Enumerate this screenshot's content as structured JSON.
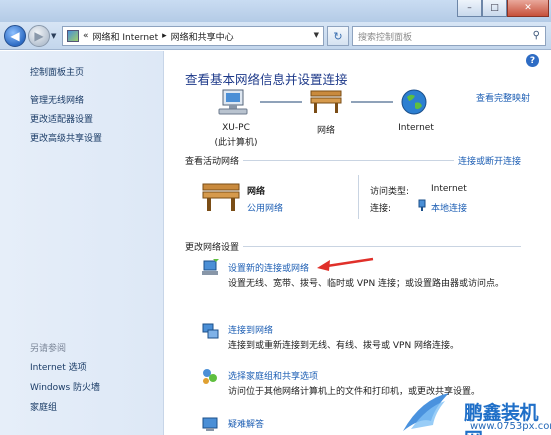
{
  "window": {
    "minimize": "–",
    "maximize": "□",
    "close": "✕"
  },
  "nav": {
    "breadcrumb_sep": "«",
    "crumb1": "网络和 Internet",
    "crumb_arrow": "▸",
    "crumb2": "网络和共享中心",
    "search_placeholder": "搜索控制面板"
  },
  "left": {
    "home": "控制面板主页",
    "links": [
      "管理无线网络",
      "更改适配器设置",
      "更改高级共享设置"
    ],
    "see_also": "另请参阅",
    "see_also_links": [
      "Internet 选项",
      "Windows 防火墙",
      "家庭组"
    ]
  },
  "main": {
    "title": "查看基本网络信息并设置连接",
    "view_full_map": "查看完整映射",
    "nodes": [
      {
        "name": "XU-PC",
        "sub": "(此计算机)"
      },
      {
        "name": "网络",
        "sub": ""
      },
      {
        "name": "Internet",
        "sub": ""
      }
    ],
    "active_section": "查看活动网络",
    "connect_disconnect": "连接或断开连接",
    "network_name": "网络",
    "network_type": "公用网络",
    "access_type_label": "访问类型:",
    "access_type_value": "Internet",
    "connection_label": "连接:",
    "connection_value": "本地连接",
    "change_section": "更改网络设置",
    "tasks": [
      {
        "link": "设置新的连接或网络",
        "desc": "设置无线、宽带、拨号、临时或 VPN 连接；或设置路由器或访问点。"
      },
      {
        "link": "连接到网络",
        "desc": "连接到或重新连接到无线、有线、拨号或 VPN 网络连接。"
      },
      {
        "link": "选择家庭组和共享选项",
        "desc": "访问位于其他网络计算机上的文件和打印机，或更改共享设置。"
      },
      {
        "link": "疑难解答",
        "desc": ""
      }
    ]
  },
  "watermark": {
    "brand": "鹏鑫装机网",
    "url": "www.0753px.com"
  },
  "colors": {
    "link": "#1e5fb4",
    "heading": "#1e3a8a",
    "arrow": "#e0302a"
  }
}
